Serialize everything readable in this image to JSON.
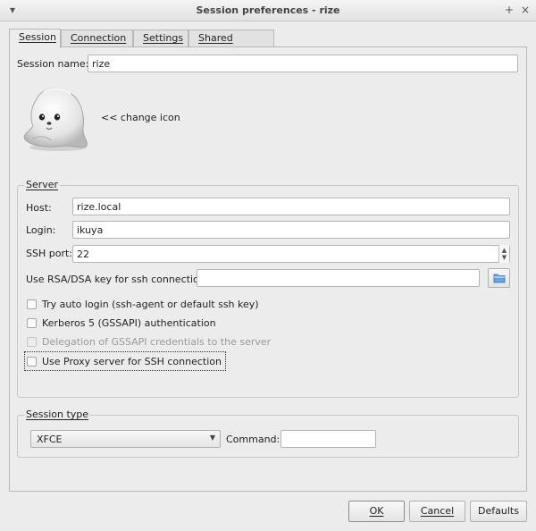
{
  "window": {
    "title": "Session preferences - rize",
    "menu_icon": "chevron-down-icon",
    "pin_glyph": "+",
    "close_glyph": "×"
  },
  "tabs": [
    {
      "label": "Session"
    },
    {
      "label": "Connection"
    },
    {
      "label": "Settings"
    },
    {
      "label": "Shared folders"
    }
  ],
  "session": {
    "name_label": "Session name:",
    "name_value": "rize",
    "change_icon_label": "<< change icon"
  },
  "server": {
    "title": "Server",
    "host_label": "Host:",
    "host_value": "rize.local",
    "login_label": "Login:",
    "login_value": "ikuya",
    "ssh_port_label": "SSH port:",
    "ssh_port_value": "22",
    "key_label": "Use RSA/DSA key for ssh connection:",
    "key_value": "",
    "options": [
      {
        "label": "Try auto login (ssh-agent or default ssh key)",
        "checked": false,
        "enabled": true
      },
      {
        "label": "Kerberos 5 (GSSAPI) authentication",
        "checked": false,
        "enabled": true
      },
      {
        "label": "Delegation of GSSAPI credentials to the server",
        "checked": false,
        "enabled": false
      },
      {
        "label": "Use Proxy server for SSH connection",
        "checked": false,
        "enabled": true
      }
    ]
  },
  "session_type": {
    "title": "Session type",
    "selected": "XFCE",
    "command_label": "Command:",
    "command_value": ""
  },
  "buttons": {
    "ok": "OK",
    "cancel": "Cancel",
    "defaults": "Defaults"
  },
  "colors": {
    "background": "#ececec",
    "border": "#b8b8b8",
    "disabled_text": "#9a9a9a"
  }
}
